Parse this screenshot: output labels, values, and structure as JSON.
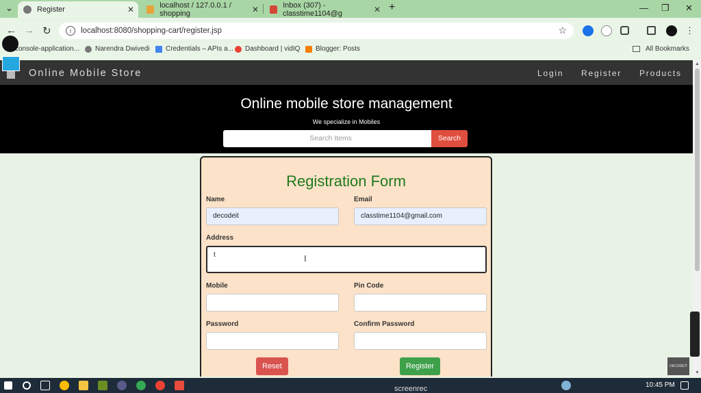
{
  "browser": {
    "tabs": [
      {
        "label": "Register",
        "active": true
      },
      {
        "label": "localhost / 127.0.0.1 / shopping",
        "active": false
      },
      {
        "label": "Inbox (307) - classtime1104@g",
        "active": false
      }
    ],
    "new_tab": "+",
    "close_glyph": "✕",
    "url": "localhost:8080/shopping-cart/register.jsp",
    "bookmarks": [
      {
        "label": "console-application..."
      },
      {
        "label": "Narendra Dwivedi"
      },
      {
        "label": "Credentials – APIs a..."
      },
      {
        "label": "Dashboard | vidIQ"
      },
      {
        "label": "Blogger: Posts"
      }
    ],
    "all_bookmarks": "All Bookmarks"
  },
  "site": {
    "brand": "Online Mobile Store",
    "nav": {
      "login": "Login",
      "register": "Register",
      "products": "Products"
    },
    "hero_title": "Online mobile store management",
    "hero_subtitle": "We specialize in Mobiles",
    "search_placeholder": "Search Items",
    "search_button": "Search"
  },
  "form": {
    "title": "Registration Form",
    "name_label": "Name",
    "name_value": "decodeit",
    "email_label": "Email",
    "email_value": "classtime1104@gmail.com",
    "address_label": "Address",
    "address_value": "t",
    "mobile_label": "Mobile",
    "mobile_value": "",
    "pincode_label": "Pin Code",
    "pincode_value": "",
    "password_label": "Password",
    "password_value": "",
    "confirm_label": "Confirm Password",
    "confirm_value": "",
    "reset_button": "Reset",
    "register_button": "Register"
  },
  "taskbar": {
    "time": "10:45 PM",
    "recorder": "screenrec"
  },
  "colors": {
    "tabbar": "#a9d6a5",
    "navbar": "#333333",
    "hero": "#000000",
    "search_button": "#e04e3f",
    "form_bg": "#fce2c8",
    "form_title": "#1e7a1e",
    "reset": "#d9534f",
    "register": "#3fa04a"
  },
  "icons": [
    "globe-icon",
    "phpmyadmin-icon",
    "gmail-icon",
    "back-icon",
    "forward-icon",
    "reload-icon",
    "info-icon",
    "star-icon",
    "extensions-icon",
    "folder-icon",
    "home-icon",
    "text-cursor-icon"
  ]
}
